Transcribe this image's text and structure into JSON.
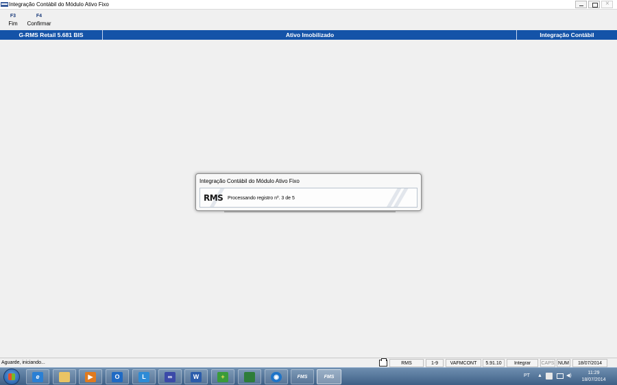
{
  "window": {
    "title": "Integração Contábil do Módulo Ativo Fixo"
  },
  "toolbar": {
    "items": [
      {
        "key": "F3",
        "label": "Fim"
      },
      {
        "key": "F4",
        "label": "Confirmar"
      }
    ]
  },
  "header": {
    "left": "G-RMS Retail 5.681 BIS",
    "center": "Ativo Imobilizado",
    "right": "Integração Contábil"
  },
  "dialog": {
    "title": "Integração Contábil do Módulo Ativo Fixo",
    "logo": "RMS",
    "message": "Processando registro nº. 3 de 5"
  },
  "statusbar": {
    "message": "Aguarde, iniciando...",
    "cells": [
      "RMS",
      "1-9",
      "VAFMCONT",
      "5.91.10",
      "Integrar",
      "CAPS",
      "NUM",
      "18/07/2014"
    ]
  },
  "taskbar": {
    "apps": [
      {
        "icon": "internet-explorer-icon",
        "glyph": "e"
      },
      {
        "icon": "file-explorer-icon",
        "glyph": ""
      },
      {
        "icon": "media-player-icon",
        "glyph": "▶"
      },
      {
        "icon": "outlook-icon",
        "glyph": "O"
      },
      {
        "icon": "lync-icon",
        "glyph": "L"
      },
      {
        "icon": "infinity-app-icon",
        "glyph": "∞"
      },
      {
        "icon": "word-icon",
        "glyph": "W"
      },
      {
        "icon": "medical-app-icon",
        "glyph": "+"
      },
      {
        "icon": "database-app-icon",
        "glyph": ""
      },
      {
        "icon": "network-app-icon",
        "glyph": "◉"
      },
      {
        "icon": "fms-app-icon",
        "glyph": "FMS"
      },
      {
        "icon": "fms-app-icon",
        "glyph": "FMS"
      }
    ],
    "language": "PT",
    "time": "11:29",
    "date": "18/07/2014"
  },
  "colors": {
    "header_blue": "#1453a8",
    "window_bg": "#f0f0f0"
  }
}
